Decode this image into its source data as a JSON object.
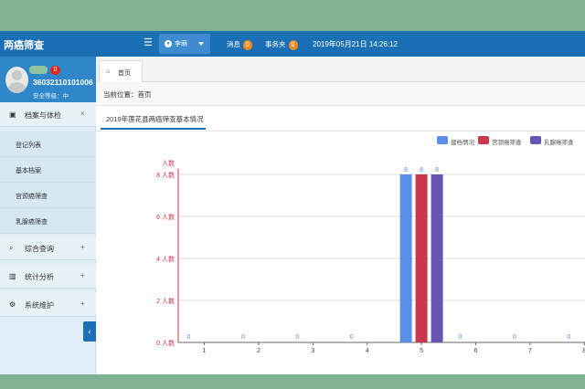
{
  "app": {
    "title": "两癌筛查"
  },
  "topbar": {
    "menu_icon": "hamburger-icon",
    "user_name": "李萌",
    "messages_label": "消息",
    "messages_count": "0",
    "affairs_label": "事务夹",
    "affairs_count": "0",
    "datetime": "2019年05月21日 14:26:12"
  },
  "profile": {
    "badge": "0",
    "id": "360321101010​06",
    "security": "安全等级：中"
  },
  "sidebar": {
    "groups": [
      {
        "icon": "file-icon",
        "label": "档案与体检",
        "action": "×"
      },
      {
        "icon": "search-icon",
        "label": "综合查询",
        "action": "+"
      },
      {
        "icon": "bar-chart-icon",
        "label": "统计分析",
        "action": "+"
      },
      {
        "icon": "gear-icon",
        "label": "系统维护",
        "action": "+"
      }
    ],
    "subitems": [
      "登记列表",
      "基本档案",
      "宫颈癌筛查",
      "乳腺癌筛查"
    ],
    "collapse_icon": "‹"
  },
  "tabs": {
    "home": "首页",
    "home_icon": "home-icon"
  },
  "breadcrumb": "当前位置：首页",
  "panel": {
    "title": "2019年莲花县两癌筛查基本情况"
  },
  "chart_data": {
    "type": "bar",
    "categories": [
      "1",
      "2",
      "3",
      "4",
      "5",
      "6",
      "7",
      "8"
    ],
    "series": [
      {
        "name": "建档情况",
        "color": "#5b8ee6",
        "values": [
          0,
          0,
          0,
          0,
          8,
          0,
          0,
          0
        ]
      },
      {
        "name": "宫颈癌筛查",
        "color": "#c9374a",
        "values": [
          0,
          0,
          0,
          0,
          8,
          0,
          0,
          0
        ]
      },
      {
        "name": "乳腺癌筛查",
        "color": "#6655b3",
        "values": [
          0,
          0,
          0,
          0,
          8,
          0,
          0,
          0
        ]
      }
    ],
    "ylabel": "人数",
    "ylim": [
      0,
      8
    ],
    "yticks": [
      "0 人数",
      "2 人数",
      "4 人数",
      "6 人数",
      "8 人数"
    ],
    "ytick_values": [
      0,
      2,
      4,
      6,
      8
    ],
    "grid": true,
    "legend": "top-right",
    "axis_color": "#d0324b"
  }
}
